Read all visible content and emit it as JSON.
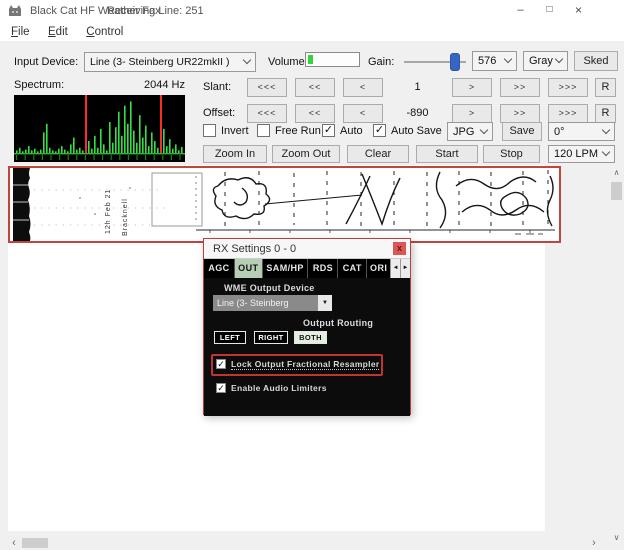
{
  "window": {
    "title": "Black Cat HF Weather Fax",
    "status": "Receiving Line: 251",
    "controls": {
      "minimize": "–",
      "maximize": "□",
      "close": "×"
    }
  },
  "menu": {
    "items": [
      "File",
      "Edit",
      "Control"
    ]
  },
  "toolbar": {
    "input_device_label": "Input Device:",
    "input_device_value": "Line (3- Steinberg UR22mkII )",
    "volume_label": "Volume:",
    "gain_label": "Gain:",
    "lines_value": "576",
    "color_mode_value": "Gray",
    "sked_label": "Sked",
    "spectrum_label": "Spectrum:",
    "spectrum_freq": "2044 Hz",
    "slant_label": "Slant:",
    "slant_value": "1",
    "offset_label": "Offset:",
    "offset_value": "-890",
    "stepper": {
      "fastback": "<<<",
      "back": "<<",
      "slowback": "<",
      "slowfwd": ">",
      "fwd": ">>",
      "fastfwd": ">>>",
      "reset": "R"
    },
    "invert_label": "Invert",
    "freerun_label": "Free Run",
    "auto_label": "Auto",
    "autosave_label": "Auto Save",
    "format_value": "JPG",
    "save_label": "Save",
    "rotation_value": "0°",
    "zoom_in_label": "Zoom In",
    "zoom_out_label": "Zoom Out",
    "clear_label": "Clear",
    "start_label": "Start",
    "stop_label": "Stop",
    "lpm_value": "120 LPM"
  },
  "checks": {
    "invert": false,
    "free_run": false,
    "auto": true,
    "auto_save": true,
    "lock_resampler": true,
    "audio_limiters": true
  },
  "spectrum": {
    "bars": [
      3,
      6,
      2,
      4,
      8,
      3,
      5,
      2,
      4,
      24,
      34,
      6,
      3,
      2,
      5,
      8,
      4,
      2,
      10,
      18,
      4,
      6,
      3,
      8,
      14,
      5,
      20,
      6,
      28,
      10,
      3,
      36,
      12,
      30,
      48,
      20,
      55,
      34,
      60,
      26,
      12,
      44,
      18,
      32,
      8,
      24,
      14,
      6,
      20,
      28,
      8,
      16,
      5,
      10,
      3,
      7
    ],
    "marker_positions": [
      71,
      146
    ],
    "bar_color": "#35e044",
    "marker_color": "#ff2a2a",
    "baseline_color": "#2db82d"
  },
  "fax": {
    "rotated_text_1": "12h Feb 21",
    "rotated_text_2": "Bracknell"
  },
  "dialog": {
    "title": "RX Settings 0 - 0",
    "close_label": "x",
    "tabs": [
      "AGC",
      "OUT",
      "SAM/HP",
      "RDS",
      "CAT",
      "ORI"
    ],
    "selected_tab": "OUT",
    "tab_left_arrow": "◄",
    "tab_right_arrow": "►",
    "wme_label": "WME Output Device",
    "device_value": "Line (3- Steinberg",
    "device_dropdown_glyph": "▼",
    "routing_label": "Output Routing",
    "routing_options": [
      "LEFT",
      "RIGHT",
      "BOTH"
    ],
    "routing_selected": "BOTH",
    "lock_resampler_label": "Lock Output Fractional Resampler",
    "audio_limiters_label": "Enable Audio Limiters"
  },
  "scrollbar": {
    "up": "∧",
    "down": "∨",
    "left": "‹",
    "right": "›"
  },
  "colors": {
    "annotation_red": "#c0443f",
    "accent_blue": "#3566c4",
    "tab_selected_green": "#b6ceb4",
    "meter_green": "#35d33c"
  }
}
